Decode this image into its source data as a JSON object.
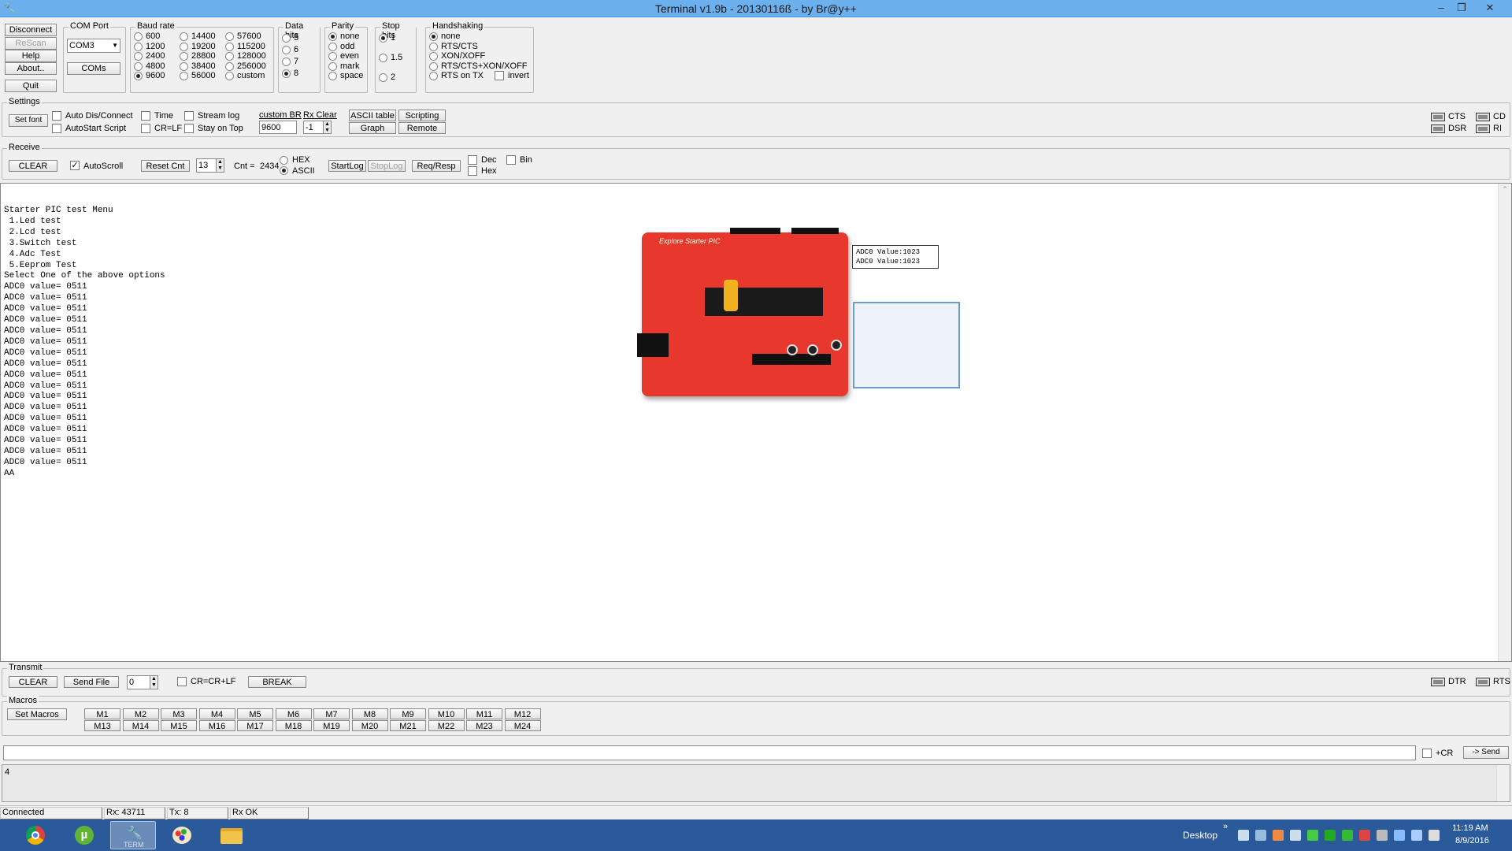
{
  "window": {
    "title": "Terminal v1.9b - 20130116ß - by Br@y++",
    "minimize": "–",
    "restore": "❐",
    "close": "✕"
  },
  "left_buttons": {
    "disconnect": "Disconnect",
    "rescan": "ReScan",
    "help": "Help",
    "about": "About..",
    "quit": "Quit"
  },
  "com_port": {
    "legend": "COM Port",
    "value": "COM3",
    "coms": "COMs"
  },
  "baud": {
    "legend": "Baud rate",
    "options": [
      "600",
      "1200",
      "2400",
      "4800",
      "9600",
      "14400",
      "19200",
      "28800",
      "38400",
      "56000",
      "57600",
      "115200",
      "128000",
      "256000",
      "custom"
    ],
    "selected": "9600"
  },
  "data_bits": {
    "legend": "Data bits",
    "options": [
      "5",
      "6",
      "7",
      "8"
    ],
    "selected": "8"
  },
  "parity": {
    "legend": "Parity",
    "options": [
      "none",
      "odd",
      "even",
      "mark",
      "space"
    ],
    "selected": "none"
  },
  "stop_bits": {
    "legend": "Stop bits",
    "options": [
      "1",
      "1.5",
      "2"
    ],
    "selected": "1"
  },
  "handshaking": {
    "legend": "Handshaking",
    "options": [
      "none",
      "RTS/CTS",
      "XON/XOFF",
      "RTS/CTS+XON/XOFF",
      "RTS on TX"
    ],
    "invert": "invert",
    "selected": "none"
  },
  "settings": {
    "legend": "Settings",
    "set_font": "Set font",
    "auto_dis": "Auto Dis/Connect",
    "autostart": "AutoStart Script",
    "time": "Time",
    "crlf": "CR=LF",
    "stream_log": "Stream log",
    "stay_on_top": "Stay on Top",
    "custom_br": "custom BR",
    "custom_br_value": "9600",
    "rx_clear": "Rx Clear",
    "rx_clear_value": "-1",
    "ascii_table": "ASCII table",
    "graph": "Graph",
    "scripting": "Scripting",
    "remote": "Remote",
    "cts": "CTS",
    "dsr": "DSR",
    "cd": "CD",
    "ri": "RI"
  },
  "receive": {
    "legend": "Receive",
    "clear": "CLEAR",
    "autoscroll": "AutoScroll",
    "reset_cnt": "Reset Cnt",
    "cnt_spin": "13",
    "cnt_label": "Cnt =",
    "cnt_value": "2434",
    "hex": "HEX",
    "ascii": "ASCII",
    "startlog": "StartLog",
    "stoplog": "StopLog",
    "reqresp": "Req/Resp",
    "dec": "Dec",
    "hex2": "Hex",
    "bin": "Bin"
  },
  "terminal_text": "Starter PIC test Menu\n 1.Led test\n 2.Lcd test\n 3.Switch test\n 4.Adc Test\n 5.Eeprom Test\nSelect One of the above options\nADC0 value= 0511\nADC0 value= 0511\nADC0 value= 0511\nADC0 value= 0511\nADC0 value= 0511\nADC0 value= 0511\nADC0 value= 0511\nADC0 value= 0511\nADC0 value= 0511\nADC0 value= 0511\nADC0 value= 0511\nADC0 value= 0511\nADC0 value= 0511\nADC0 value= 0511\nADC0 value= 0511\nADC0 value= 0511\nADC0 value= 0511\nAA",
  "overlay": {
    "board_label": "Explore Starter PIC",
    "callout_line1": "ADC0 Value:1023",
    "callout_line2": "ADC0 Value:1023"
  },
  "transmit": {
    "legend": "Transmit",
    "clear": "CLEAR",
    "send_file": "Send File",
    "spin_value": "0",
    "crcrlf": "CR=CR+LF",
    "break": "BREAK",
    "dtr": "DTR",
    "rts": "RTS"
  },
  "macros": {
    "legend": "Macros",
    "set_macros": "Set Macros",
    "row1": [
      "M1",
      "M2",
      "M3",
      "M4",
      "M5",
      "M6",
      "M7",
      "M8",
      "M9",
      "M10",
      "M11",
      "M12"
    ],
    "row2": [
      "M13",
      "M14",
      "M15",
      "M16",
      "M17",
      "M18",
      "M19",
      "M20",
      "M21",
      "M22",
      "M23",
      "M24"
    ]
  },
  "send": {
    "input_value": "",
    "plus_cr": "+CR",
    "send": "-> Send",
    "log_text": "4"
  },
  "status": {
    "connected": "Connected",
    "rx": "Rx: 43711",
    "tx": "Tx: 8",
    "rxok": "Rx OK"
  },
  "taskbar": {
    "desktop": "Desktop",
    "time": "11:19 AM",
    "date": "8/9/2016",
    "term_label": "TERM",
    "chevron": "»"
  }
}
